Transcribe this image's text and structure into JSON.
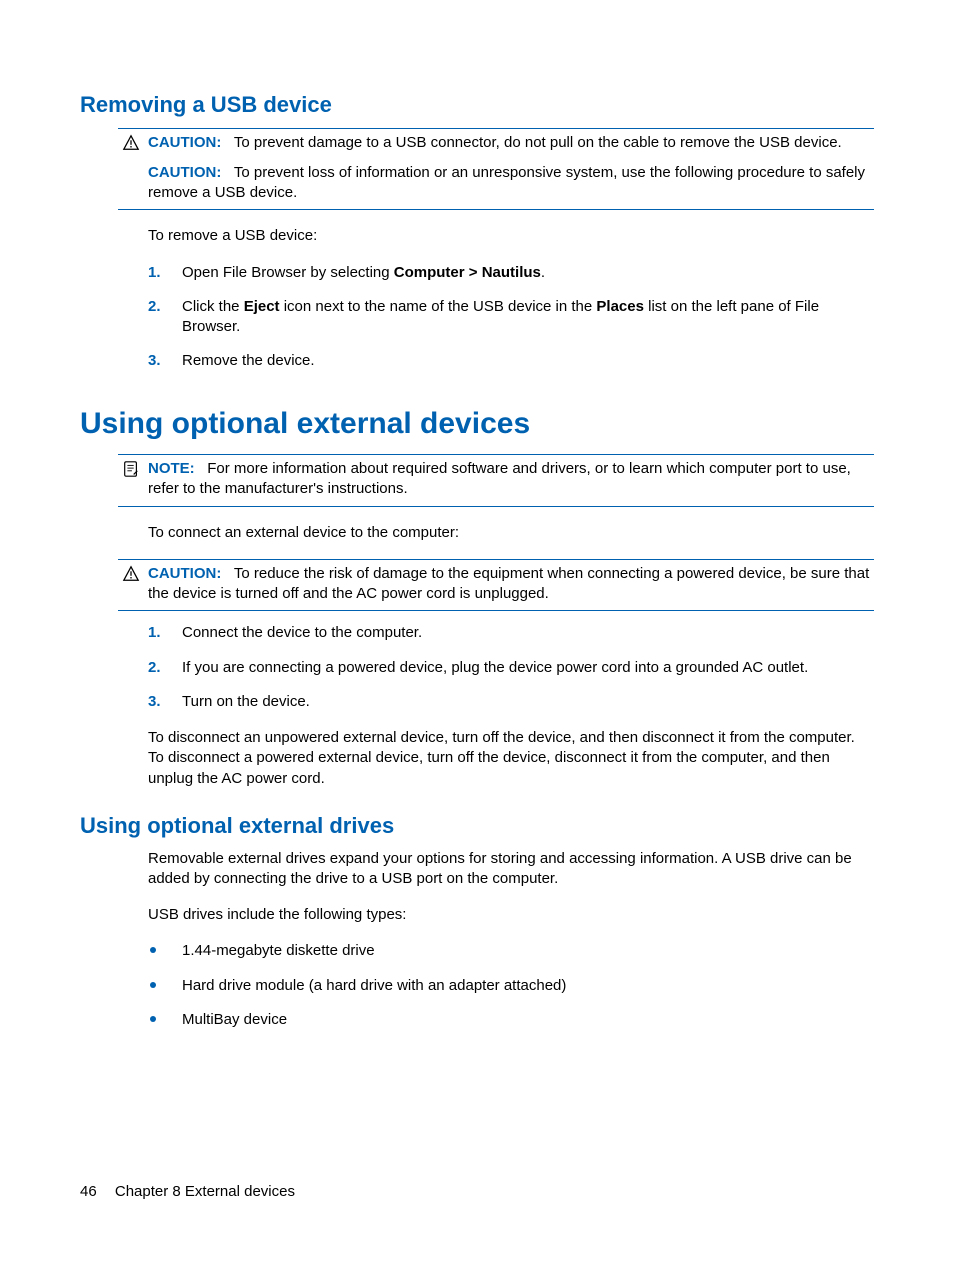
{
  "section1": {
    "title": "Removing a USB device",
    "caution1_label": "CAUTION:",
    "caution1_text": "To prevent damage to a USB connector, do not pull on the cable to remove the USB device.",
    "caution2_label": "CAUTION:",
    "caution2_text": "To prevent loss of information or an unresponsive system, use the following procedure to safely remove a USB device.",
    "intro": "To remove a USB device:",
    "steps": {
      "s1_a": "Open File Browser by selecting ",
      "s1_b": "Computer > Nautilus",
      "s1_c": ".",
      "s2_a": "Click the ",
      "s2_b": "Eject",
      "s2_c": " icon next to the name of the USB device in the ",
      "s2_d": "Places",
      "s2_e": " list on the left pane of File Browser.",
      "s3": "Remove the device."
    },
    "nums": {
      "n1": "1.",
      "n2": "2.",
      "n3": "3."
    }
  },
  "section2": {
    "title": "Using optional external devices",
    "note_label": "NOTE:",
    "note_text": "For more information about required software and drivers, or to learn which computer port to use, refer to the manufacturer's instructions.",
    "intro": "To connect an external device to the computer:",
    "caution_label": "CAUTION:",
    "caution_text": "To reduce the risk of damage to the equipment when connecting a powered device, be sure that the device is turned off and the AC power cord is unplugged.",
    "steps": {
      "s1": "Connect the device to the computer.",
      "s2": "If you are connecting a powered device, plug the device power cord into a grounded AC outlet.",
      "s3": "Turn on the device."
    },
    "nums": {
      "n1": "1.",
      "n2": "2.",
      "n3": "3."
    },
    "outro": "To disconnect an unpowered external device, turn off the device, and then disconnect it from the computer. To disconnect a powered external device, turn off the device, disconnect it from the computer, and then unplug the AC power cord."
  },
  "section3": {
    "title": "Using optional external drives",
    "p1": "Removable external drives expand your options for storing and accessing information. A USB drive can be added by connecting the drive to a USB port on the computer.",
    "p2": "USB drives include the following types:",
    "bullets": {
      "b1": "1.44-megabyte diskette drive",
      "b2": "Hard drive module (a hard drive with an adapter attached)",
      "b3": "MultiBay device"
    }
  },
  "footer": {
    "page": "46",
    "chapter": "Chapter 8   External devices"
  }
}
